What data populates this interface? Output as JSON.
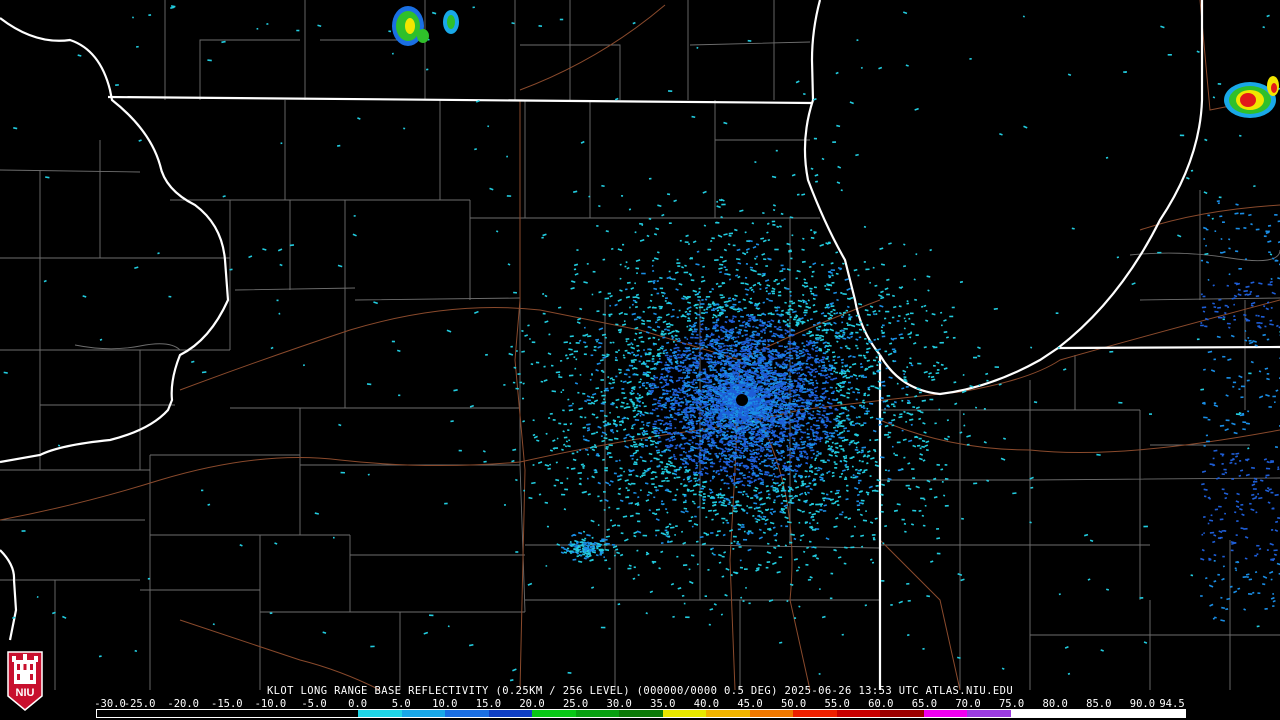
{
  "product": {
    "caption": "KLOT LONG RANGE BASE REFLECTIVITY (0.25KM / 256 LEVEL) (000000/0000 0.5 DEG) 2025-06-26 13:53 UTC  ATLAS.NIU.EDU"
  },
  "logo": {
    "text": "NIU"
  },
  "colorbar": {
    "labels": [
      "-30.0",
      "-25.0",
      "-20.0",
      "-15.0",
      "-10.0",
      "-5.0",
      "0.0",
      "5.0",
      "10.0",
      "15.0",
      "20.0",
      "25.0",
      "30.0",
      "35.0",
      "40.0",
      "45.0",
      "50.0",
      "55.0",
      "60.0",
      "65.0",
      "70.0",
      "75.0",
      "80.0",
      "85.0",
      "90.0",
      "94.5"
    ],
    "colors": [
      "#000000",
      "#000000",
      "#000000",
      "#000000",
      "#000000",
      "#000000",
      "#1fd6e6",
      "#19a8e8",
      "#1a6fe3",
      "#0f3fc4",
      "#08c816",
      "#07a010",
      "#0c7a08",
      "#e8e800",
      "#f2b400",
      "#f07800",
      "#ee2000",
      "#c80000",
      "#9c0000",
      "#f000f0",
      "#9a3ce0",
      "#ffffff",
      "#ffffff",
      "#ffffff",
      "#ffffff"
    ]
  },
  "colors": {
    "background": "#000000",
    "county_lines": "#6e6e6e",
    "state_lines": "#ffffff",
    "highways": "#8a4a2c",
    "echo_light": "#22cde0",
    "echo_mid": "#1a8ee6",
    "echo_dense": "#1e5ed8",
    "storm_green": "#2fc02a",
    "storm_yellow": "#f2e600",
    "storm_red": "#e21a1a",
    "logo_red": "#c8102e"
  },
  "radar": {
    "site": "KLOT"
  }
}
